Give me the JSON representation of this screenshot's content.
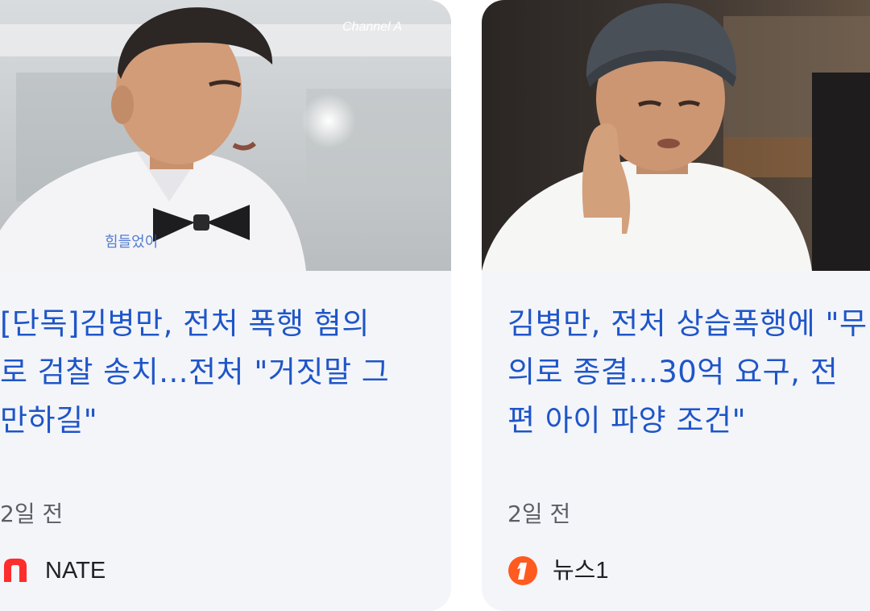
{
  "cards": [
    {
      "headline": "[단독]김병만, 전처 폭행 혐의\n로 검찰 송치...전처 \"거짓말 그\n만하길\"",
      "time": "2일 전",
      "source": "NATE",
      "thumb_watermark": "Channel A",
      "thumb_caption": "힘들었이",
      "logo_color": "#ff2c2c",
      "logo_icon": "nate-n-logo"
    },
    {
      "headline": "김병만, 전처 상습폭행에 \"무\n의로 종결...30억 요구, 전\n편 아이 파양 조건\"",
      "time": "2일 전",
      "source": "뉴스1",
      "logo_color": "#ff5a1f",
      "logo_icon": "news1-logo"
    }
  ],
  "colors": {
    "headline": "#1f55c8",
    "card_background": "#f3f5f9",
    "meta_text": "#5b5e65"
  }
}
